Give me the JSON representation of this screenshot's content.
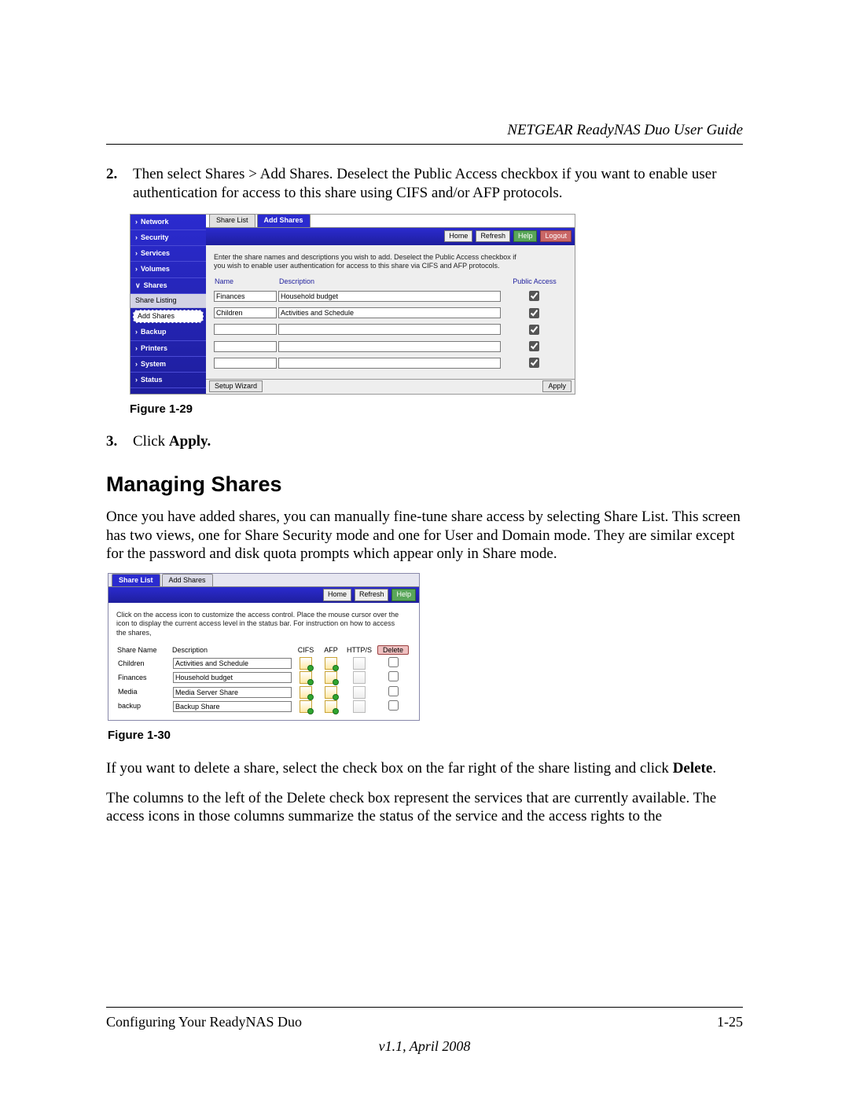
{
  "header": {
    "title": "NETGEAR ReadyNAS Duo User Guide"
  },
  "step2": {
    "num": "2.",
    "text_a": "Then select Shares > Add Shares. Deselect the Public Access checkbox if you want to enable user authentication for access to this share using CIFS and/or AFP protocols."
  },
  "fig29": {
    "sidebar": {
      "network": "Network",
      "security": "Security",
      "services": "Services",
      "volumes": "Volumes",
      "shares": "Shares",
      "share_listing": "Share Listing",
      "add_shares": "Add Shares",
      "backup": "Backup",
      "printers": "Printers",
      "system": "System",
      "status": "Status"
    },
    "tabs": {
      "share_list": "Share List",
      "add_shares": "Add Shares"
    },
    "toolbar": {
      "home": "Home",
      "refresh": "Refresh",
      "help": "Help",
      "logout": "Logout"
    },
    "instructions": "Enter the share names and descriptions you wish to add. Deselect the Public Access checkbox if you wish to enable user authentication for access to this share via CIFS and AFP protocols.",
    "cols": {
      "name": "Name",
      "desc": "Description",
      "public": "Public Access"
    },
    "rows": [
      {
        "name": "Finances",
        "desc": "Household budget",
        "checked": true
      },
      {
        "name": "Children",
        "desc": "Activities and Schedule",
        "checked": true
      },
      {
        "name": "",
        "desc": "",
        "checked": true
      },
      {
        "name": "",
        "desc": "",
        "checked": true
      },
      {
        "name": "",
        "desc": "",
        "checked": true
      }
    ],
    "footer": {
      "setup_wizard": "Setup Wizard",
      "apply": "Apply"
    },
    "caption": "Figure 1-29"
  },
  "step3": {
    "num": "3.",
    "text_pre": "Click ",
    "text_bold": "Apply."
  },
  "section_heading": "Managing Shares",
  "para1": "Once you have added shares, you can manually fine-tune share access by selecting Share List. This screen has two views, one for Share Security mode and one for User and Domain mode. They are similar except for the password and disk quota prompts which appear only in Share mode.",
  "fig30": {
    "tabs": {
      "share_list": "Share List",
      "add_shares": "Add Shares"
    },
    "toolbar": {
      "home": "Home",
      "refresh": "Refresh",
      "help": "Help"
    },
    "instructions": "Click on the access icon to customize the access control. Place the mouse cursor over the icon to display the current access level in the status bar. For instruction on how to access the shares,",
    "cols": {
      "share_name": "Share Name",
      "desc": "Description",
      "cifs": "CIFS",
      "afp": "AFP",
      "https": "HTTP/S",
      "delete": "Delete"
    },
    "rows": [
      {
        "name": "Children",
        "desc": "Activities and Schedule"
      },
      {
        "name": "Finances",
        "desc": "Household budget"
      },
      {
        "name": "Media",
        "desc": "Media Server Share"
      },
      {
        "name": "backup",
        "desc": "Backup Share"
      }
    ],
    "caption": "Figure 1-30"
  },
  "para2_a": "If you want to delete a share, select the check box on the far right of the share listing and click ",
  "para2_bold": "Delete",
  "para2_b": ".",
  "para3": "The columns to the left of the Delete check box represent the services that are currently available. The access icons in those columns summarize the status of the service and the access rights to the",
  "footer": {
    "left": "Configuring Your ReadyNAS Duo",
    "right": "1-25",
    "version": "v1.1, April 2008"
  }
}
